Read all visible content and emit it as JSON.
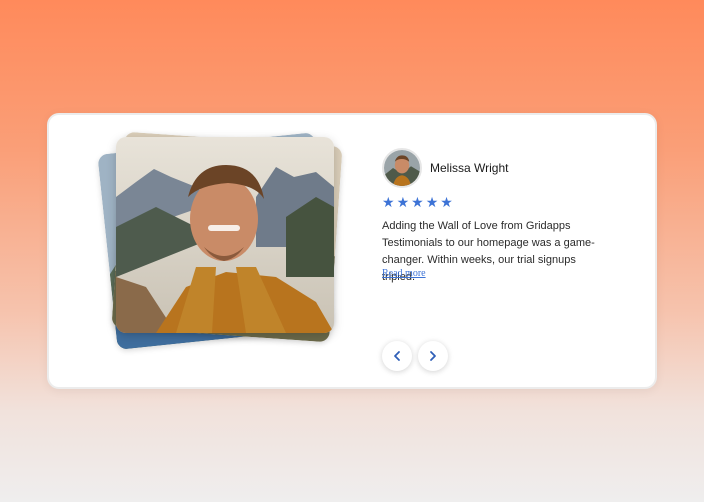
{
  "testimonial": {
    "author_name": "Melissa Wright",
    "rating": 5,
    "rating_max": 5,
    "star_glyph": "★",
    "quote": "Adding the Wall of Love from Gridapps Testimonials to our homepage was a game-changer. Within weeks, our trial signups tripled.",
    "read_more_label": "Read more"
  },
  "navigation": {
    "prev_icon": "chevron-left-icon",
    "next_icon": "chevron-right-icon"
  },
  "colors": {
    "accent": "#3d73d6",
    "background_top": "#ff8a5b",
    "background_bottom": "#efeeee",
    "card": "#ffffff"
  }
}
